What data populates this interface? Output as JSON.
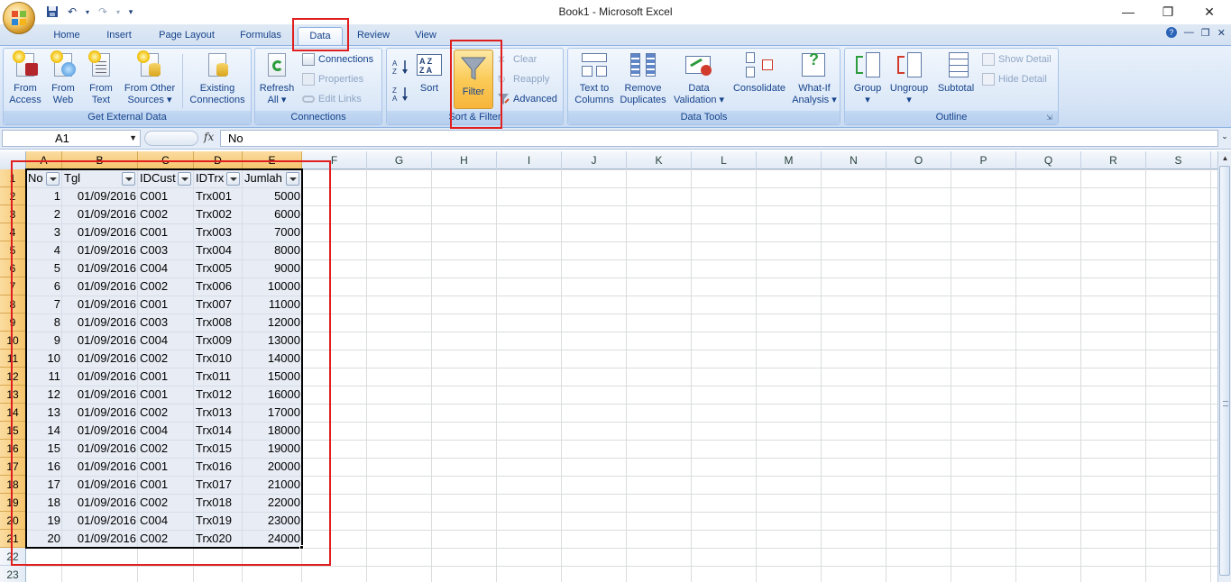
{
  "window": {
    "title": "Book1 - Microsoft Excel"
  },
  "qat": {
    "save": "save-icon",
    "undo": "undo-icon",
    "redo": "redo-icon"
  },
  "tabs": [
    "Home",
    "Insert",
    "Page Layout",
    "Formulas",
    "Data",
    "Review",
    "View"
  ],
  "active_tab": "Data",
  "ribbon": {
    "get_external_data": {
      "label": "Get External Data",
      "buttons": [
        {
          "l1": "From",
          "l2": "Access"
        },
        {
          "l1": "From",
          "l2": "Web"
        },
        {
          "l1": "From",
          "l2": "Text"
        },
        {
          "l1": "From Other",
          "l2": "Sources ▾"
        },
        {
          "l1": "Existing",
          "l2": "Connections"
        }
      ]
    },
    "connections": {
      "label": "Connections",
      "refresh": {
        "l1": "Refresh",
        "l2": "All ▾"
      },
      "connections": "Connections",
      "properties": "Properties",
      "edit_links": "Edit Links"
    },
    "sort_filter": {
      "label": "Sort & Filter",
      "sort": "Sort",
      "filter": "Filter",
      "clear": "Clear",
      "reapply": "Reapply",
      "advanced": "Advanced"
    },
    "data_tools": {
      "label": "Data Tools",
      "buttons": [
        {
          "l1": "Text to",
          "l2": "Columns"
        },
        {
          "l1": "Remove",
          "l2": "Duplicates"
        },
        {
          "l1": "Data",
          "l2": "Validation ▾"
        },
        {
          "l1": "Consolidate",
          "l2": ""
        },
        {
          "l1": "What-If",
          "l2": "Analysis ▾"
        }
      ]
    },
    "outline": {
      "label": "Outline",
      "group": "Group",
      "ungroup": "Ungroup",
      "subtotal": "Subtotal",
      "show_detail": "Show Detail",
      "hide_detail": "Hide Detail"
    }
  },
  "formula_bar": {
    "name_box": "A1",
    "fx": "fx",
    "content": "No"
  },
  "columns": [
    "A",
    "B",
    "C",
    "D",
    "E",
    "F",
    "G",
    "H",
    "I",
    "J",
    "K",
    "L",
    "M",
    "N",
    "O",
    "P",
    "Q",
    "R",
    "S"
  ],
  "rows": [
    "1",
    "2",
    "3",
    "4",
    "5",
    "6",
    "7",
    "8",
    "9",
    "10",
    "11",
    "12",
    "13",
    "14",
    "15",
    "16",
    "17",
    "18",
    "19",
    "20",
    "21",
    "22",
    "23"
  ],
  "headers": [
    "No",
    "Tgl",
    "IDCust",
    "IDTrx",
    "Jumlah"
  ],
  "table": [
    [
      "1",
      "01/09/2016",
      "C001",
      "Trx001",
      "5000"
    ],
    [
      "2",
      "01/09/2016",
      "C002",
      "Trx002",
      "6000"
    ],
    [
      "3",
      "01/09/2016",
      "C001",
      "Trx003",
      "7000"
    ],
    [
      "4",
      "01/09/2016",
      "C003",
      "Trx004",
      "8000"
    ],
    [
      "5",
      "01/09/2016",
      "C004",
      "Trx005",
      "9000"
    ],
    [
      "6",
      "01/09/2016",
      "C002",
      "Trx006",
      "10000"
    ],
    [
      "7",
      "01/09/2016",
      "C001",
      "Trx007",
      "11000"
    ],
    [
      "8",
      "01/09/2016",
      "C003",
      "Trx008",
      "12000"
    ],
    [
      "9",
      "01/09/2016",
      "C004",
      "Trx009",
      "13000"
    ],
    [
      "10",
      "01/09/2016",
      "C002",
      "Trx010",
      "14000"
    ],
    [
      "11",
      "01/09/2016",
      "C001",
      "Trx011",
      "15000"
    ],
    [
      "12",
      "01/09/2016",
      "C001",
      "Trx012",
      "16000"
    ],
    [
      "13",
      "01/09/2016",
      "C002",
      "Trx013",
      "17000"
    ],
    [
      "14",
      "01/09/2016",
      "C004",
      "Trx014",
      "18000"
    ],
    [
      "15",
      "01/09/2016",
      "C002",
      "Trx015",
      "19000"
    ],
    [
      "16",
      "01/09/2016",
      "C001",
      "Trx016",
      "20000"
    ],
    [
      "17",
      "01/09/2016",
      "C001",
      "Trx017",
      "21000"
    ],
    [
      "18",
      "01/09/2016",
      "C002",
      "Trx018",
      "22000"
    ],
    [
      "19",
      "01/09/2016",
      "C004",
      "Trx019",
      "23000"
    ],
    [
      "20",
      "01/09/2016",
      "C002",
      "Trx020",
      "24000"
    ]
  ],
  "colors": {
    "highlight": "#e01e1e",
    "selected_header": "#f5c46b",
    "ribbon": "#d6e4f6"
  }
}
